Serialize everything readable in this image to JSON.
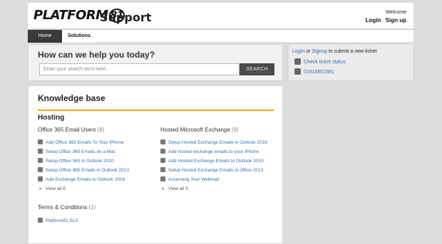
{
  "header": {
    "logo_text": "PLATFORM",
    "logo_mark": "81",
    "title": "Support",
    "welcome": "Welcome",
    "login": "Login",
    "signup": "Sign up"
  },
  "nav": {
    "tabs": [
      {
        "label": "Home"
      },
      {
        "label": "Solutions"
      }
    ]
  },
  "search": {
    "title": "How can we help you today?",
    "placeholder": "Enter your search term here...",
    "button": "SEARCH"
  },
  "ticket": {
    "login": "Login",
    "or": " or ",
    "signup": "Signup",
    "rest": " to submit a new ticket",
    "check_status": "Check ticket status",
    "phone": "01618502381"
  },
  "kb": {
    "title": "Knowledge base",
    "category": "Hosting",
    "folders": [
      {
        "name": "Office 365 Email Users",
        "count": "(8)",
        "articles": [
          "Add Office 365 Emails To Your iPhone",
          "Setup Office 365 Emails on a Mac",
          "Setup Office 365 in Outlook 2010",
          "Setup Office 365 Emails in Outlook 2013",
          "Add Exchange Emails to Outlook 2016"
        ],
        "view_all": "View all 8"
      },
      {
        "name": "Hosted Microsoft Exchange",
        "count": "(9)",
        "articles": [
          "Setup Hosted Exchange Emails in Outlook 2016",
          "Add hosted exchange emails to your iPhone",
          "Add Hosted Exchange Emails to Outlook 2010",
          "Setup Hosted Exchange Emails in Office 2013",
          "Accessing Your Webmail"
        ],
        "view_all": "View all 9"
      },
      {
        "name": "Terms & Conditions",
        "count": "(1)",
        "articles": [
          "Platform81 SLA"
        ]
      }
    ]
  },
  "colors": {
    "accent": "#f5a623",
    "link": "#2f6fb3",
    "nav_active": "#3a3a3a"
  }
}
